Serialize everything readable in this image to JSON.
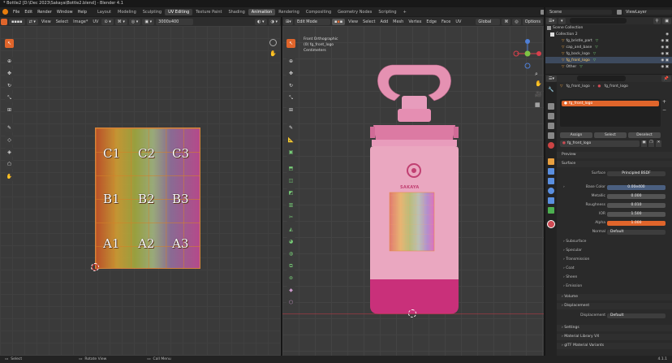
{
  "title": "* Bottle2 [D:\\Dec 2023\\Sakaya\\Bottle2.blend] - Blender 4.1",
  "menu": [
    "File",
    "Edit",
    "Render",
    "Window",
    "Help"
  ],
  "workspaces": [
    "Layout",
    "Modeling",
    "Sculpting",
    "UV Editing",
    "Texture Paint",
    "Shading",
    "Animation",
    "Rendering",
    "Compositing",
    "Geometry Nodes",
    "Scripting"
  ],
  "active_workspace": "UV Editing",
  "scene": {
    "label": "Scene",
    "view_layer": "ViewLayer"
  },
  "uv_editor": {
    "header": [
      "View",
      "Select",
      "Image*",
      "UV"
    ],
    "image_name": "3000x400",
    "labels": [
      "C1",
      "C2",
      "C3",
      "B1",
      "B2",
      "B3",
      "A1",
      "A2",
      "A3"
    ]
  },
  "viewport": {
    "mode": "Edit Mode",
    "header": [
      "View",
      "Select",
      "Add",
      "Mesh",
      "Vertex",
      "Edge",
      "Face",
      "UV"
    ],
    "orientation": "Global",
    "options": "Options",
    "overlay_line1": "Front Orthographic",
    "overlay_line2": "(0) fg_front_logo",
    "overlay_line3": "Centimeters",
    "brand": "SAKAYA"
  },
  "outliner": {
    "search": "",
    "items": [
      {
        "name": "Scene Collection",
        "indent": 0
      },
      {
        "name": "Collection 2",
        "indent": 1
      },
      {
        "name": "fg_bristle_part",
        "indent": 2
      },
      {
        "name": "cap_and_base",
        "indent": 2
      },
      {
        "name": "fg_back_logo",
        "indent": 2
      },
      {
        "name": "fg_front_logo",
        "indent": 2,
        "selected": true
      },
      {
        "name": "Other",
        "indent": 2
      }
    ]
  },
  "properties": {
    "object": "fg_front_logo",
    "object2": "fg_front_logo",
    "material_slot": "fg_front_logo",
    "buttons": [
      "Assign",
      "Select",
      "Deselect"
    ],
    "material_name": "fg_front_logo",
    "sections": {
      "preview": "Preview",
      "surface": "Surface"
    },
    "surface_label": "Surface",
    "surface_value": "Principled BSDF",
    "rows": [
      {
        "label": "Base Color",
        "value": "0.00e400"
      },
      {
        "label": "Metallic",
        "value": "0.000"
      },
      {
        "label": "Roughness",
        "value": "0.010"
      },
      {
        "label": "IOR",
        "value": "1.500"
      },
      {
        "label": "Alpha",
        "value": "1.000"
      },
      {
        "label": "Normal",
        "value": "Default"
      }
    ],
    "subsections": [
      "Subsurface",
      "Specular",
      "Transmission",
      "Coat",
      "Sheen",
      "Emission"
    ],
    "volume": "Volume",
    "displacement": "Displacement",
    "displacement_label": "Displacement",
    "displacement_value": "Default",
    "settings": "Settings",
    "material_library": "Material Library VX",
    "gltf": "glTF Material Variants"
  },
  "status": {
    "select": "Select",
    "rotate": "Rotate View",
    "menu": "Call Menu",
    "version": "4.1.1"
  },
  "colors": {
    "accent": "#e0652b",
    "selection": "#4772b3",
    "bottle_pink": "#e6a3ba",
    "magenta": "#c9307a"
  }
}
